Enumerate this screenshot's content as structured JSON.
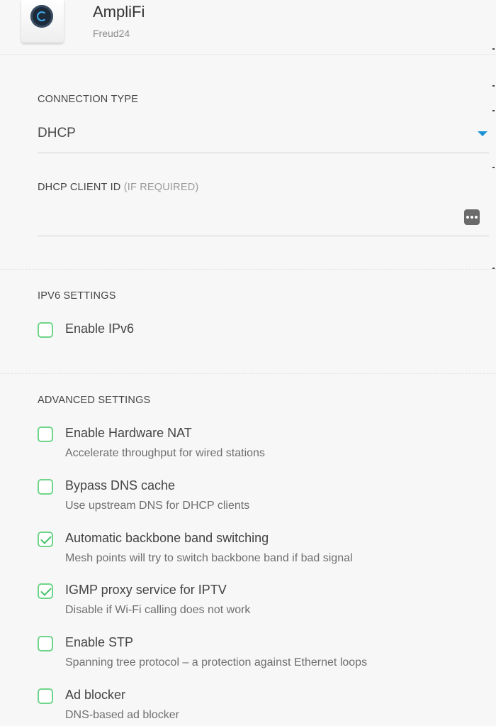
{
  "header": {
    "device_name": "AmpliFi",
    "device_sub": "Freud24"
  },
  "connection": {
    "label": "CONNECTION TYPE",
    "value": "DHCP",
    "client_id_label": "DHCP CLIENT ID",
    "client_id_hint": "(IF REQUIRED)",
    "client_id_value": ""
  },
  "ipv6": {
    "label": "IPV6 SETTINGS",
    "options": [
      {
        "label": "Enable IPv6",
        "checked": false
      }
    ]
  },
  "advanced": {
    "label": "ADVANCED SETTINGS",
    "options": [
      {
        "label": "Enable Hardware NAT",
        "desc": "Accelerate throughput for wired stations",
        "checked": false
      },
      {
        "label": "Bypass DNS cache",
        "desc": "Use upstream DNS for DHCP clients",
        "checked": false
      },
      {
        "label": "Automatic backbone band switching",
        "desc": "Mesh points will try to switch backbone band if bad signal",
        "checked": true
      },
      {
        "label": "IGMP proxy service for IPTV",
        "desc": "Disable if Wi-Fi calling does not work",
        "checked": true
      },
      {
        "label": "Enable STP",
        "desc": "Spanning tree protocol – a protection against Ethernet loops",
        "checked": false
      },
      {
        "label": "Ad blocker",
        "desc": "DNS-based ad blocker",
        "checked": false
      }
    ]
  },
  "icons": {
    "select_caret": "chevron-down-icon",
    "password_toggle": "more-dots-icon",
    "device": "router-icon"
  },
  "colors": {
    "accent": "#1a93d5",
    "checkbox": "#6fd58a",
    "check": "#44c068"
  }
}
